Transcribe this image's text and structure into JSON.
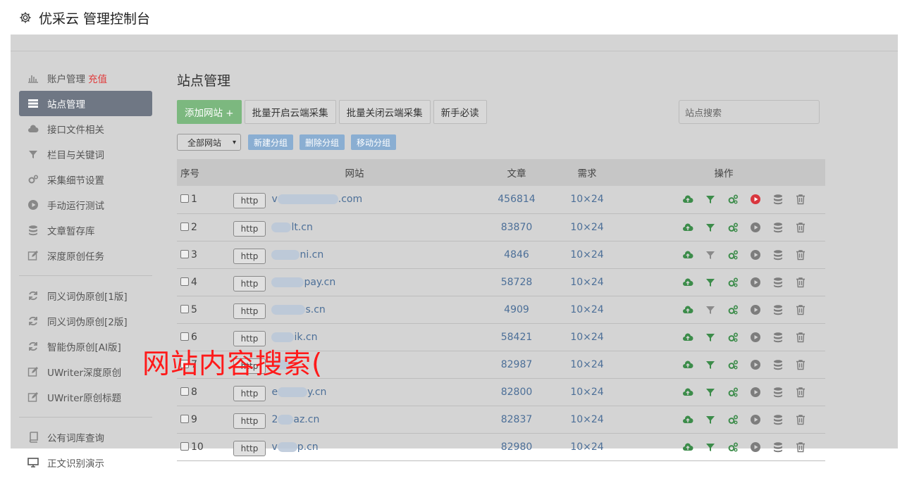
{
  "header": {
    "title": "优采云 管理控制台",
    "icon": "gear-icon"
  },
  "sidebar": {
    "account": {
      "label": "账户管理",
      "recharge": "充值"
    },
    "items": [
      {
        "label": "站点管理",
        "icon": "server-icon"
      },
      {
        "label": "接口文件相关",
        "icon": "cloud-icon"
      },
      {
        "label": "栏目与关键词",
        "icon": "filter-icon"
      },
      {
        "label": "采集细节设置",
        "icon": "gears-icon"
      },
      {
        "label": "手动运行测试",
        "icon": "play-icon"
      },
      {
        "label": "文章暂存库",
        "icon": "database-icon"
      },
      {
        "label": "深度原创任务",
        "icon": "edit-icon"
      }
    ],
    "group2": [
      {
        "label": "同义词伪原创[1版]",
        "icon": "refresh-icon"
      },
      {
        "label": "同义词伪原创[2版]",
        "icon": "refresh-icon"
      },
      {
        "label": "智能伪原创[AI版]",
        "icon": "refresh-icon"
      },
      {
        "label": "UWriter深度原创",
        "icon": "edit-icon"
      },
      {
        "label": "UWriter原创标题",
        "icon": "edit-icon"
      }
    ],
    "group3": [
      {
        "label": "公有词库查询",
        "icon": "book-icon"
      },
      {
        "label": "正文识别演示",
        "icon": "monitor-icon"
      }
    ]
  },
  "main": {
    "title": "站点管理",
    "toolbar": {
      "add": "添加网站 +",
      "enable": "批量开启云端采集",
      "disable": "批量关闭云端采集",
      "guide": "新手必读"
    },
    "search_placeholder": "站点搜索",
    "filter_select": "全部网站",
    "group_buttons": {
      "new": "新建分组",
      "delete": "删除分组",
      "move": "移动分组"
    },
    "table": {
      "headers": {
        "num": "序号",
        "site": "网站",
        "articles": "文章",
        "demand": "需求",
        "ops": "操作"
      },
      "http_label": "http",
      "rows": [
        {
          "num": "1",
          "domain_prefix": "v",
          "domain_suffix": ".com",
          "articles": "456814",
          "demand": "10×24"
        },
        {
          "num": "2",
          "domain_prefix": "",
          "domain_suffix": "lt.cn",
          "articles": "83870",
          "demand": "10×24"
        },
        {
          "num": "3",
          "domain_prefix": "",
          "domain_suffix": "ni.cn",
          "articles": "4846",
          "demand": "10×24"
        },
        {
          "num": "4",
          "domain_prefix": "",
          "domain_suffix": "pay.cn",
          "articles": "58728",
          "demand": "10×24"
        },
        {
          "num": "5",
          "domain_prefix": "",
          "domain_suffix": "s.cn",
          "articles": "4909",
          "demand": "10×24"
        },
        {
          "num": "6",
          "domain_prefix": "",
          "domain_suffix": "ik.cn",
          "articles": "58421",
          "demand": "10×24"
        },
        {
          "num": "7",
          "domain_prefix": "",
          "domain_suffix": "",
          "articles": "82987",
          "demand": "10×24"
        },
        {
          "num": "8",
          "domain_prefix": "e",
          "domain_suffix": "y.cn",
          "articles": "82800",
          "demand": "10×24"
        },
        {
          "num": "9",
          "domain_prefix": "2",
          "domain_suffix": "az.cn",
          "articles": "82837",
          "demand": "10×24"
        },
        {
          "num": "10",
          "domain_prefix": "v",
          "domain_suffix": "p.cn",
          "articles": "82980",
          "demand": "10×24"
        }
      ]
    }
  },
  "overlay_text": "网站内容搜索(",
  "colors": {
    "green": "#7cb87f",
    "accent_blue": "#8aaed2",
    "link": "#4c6f98",
    "red": "#e03b3b"
  }
}
